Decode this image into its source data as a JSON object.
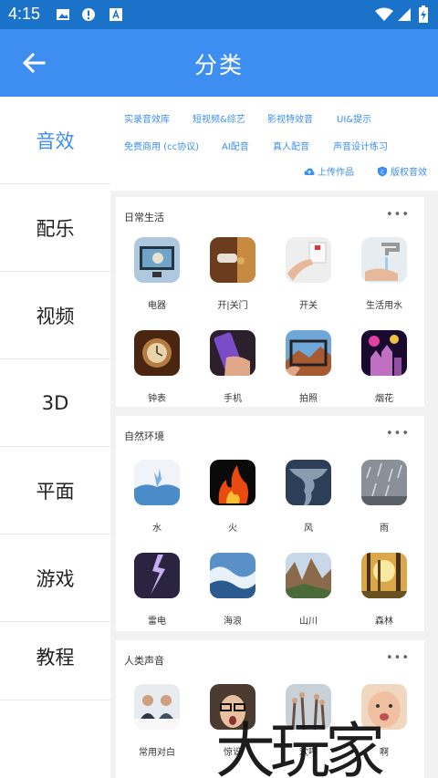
{
  "status": {
    "time": "4:15"
  },
  "appbar": {
    "title": "分类"
  },
  "sidebar": {
    "items": [
      {
        "label": "音效",
        "active": true
      },
      {
        "label": "配乐"
      },
      {
        "label": "视频"
      },
      {
        "label": "3D"
      },
      {
        "label": "平面"
      },
      {
        "label": "游戏"
      },
      {
        "label": "教程"
      }
    ]
  },
  "tags": [
    "实录音效库",
    "短视频&综艺",
    "影视特效音",
    "UI&提示",
    "免费商用 (cc协议)",
    "AI配音",
    "真人配音",
    "声音设计练习"
  ],
  "actions": {
    "upload": "上传作品",
    "copyright": "版权音效"
  },
  "sections": [
    {
      "title": "日常生活",
      "more": "•••",
      "items": [
        "电器",
        "开|关门",
        "开关",
        "生活用水",
        "钟表",
        "手机",
        "拍照",
        "烟花"
      ]
    },
    {
      "title": "自然环境",
      "more": "•••",
      "items": [
        "水",
        "火",
        "风",
        "雨",
        "雷电",
        "海浪",
        "山川",
        "森林"
      ]
    },
    {
      "title": "人类声音",
      "more": "•••",
      "items": [
        "常用对白",
        "惊讶",
        "欢呼",
        "啊"
      ]
    }
  ],
  "watermark": "大玩家",
  "colors": {
    "accent": "#3d8ef0",
    "statusbar": "#1a73c9"
  }
}
